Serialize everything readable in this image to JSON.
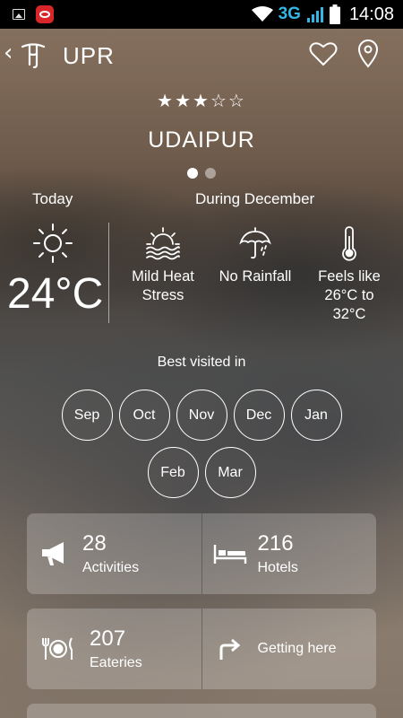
{
  "status_bar": {
    "network": "3G",
    "time": "14:08"
  },
  "header": {
    "back_glyph": "‹",
    "city_code": "UPR",
    "logo_icon": "tourism-logo-icon",
    "favorite_icon": "heart-icon",
    "location_icon": "map-pin-icon"
  },
  "rating": {
    "value": 3,
    "max": 5,
    "display": "★★★☆☆"
  },
  "city_name": "UDAIPUR",
  "pager": {
    "count": 2,
    "active": 0
  },
  "weather": {
    "today_label": "Today",
    "today_temp": "24°C",
    "today_icon": "sun-icon",
    "period_label": "During December",
    "items": [
      {
        "icon": "heat-waves-icon",
        "label_line1": "Mild Heat",
        "label_line2": "Stress",
        "label_line3": ""
      },
      {
        "icon": "umbrella-rain-icon",
        "label_line1": "No Rainfall",
        "label_line2": "",
        "label_line3": ""
      },
      {
        "icon": "thermometer-icon",
        "label_line1": "Feels like",
        "label_line2": "26°C to",
        "label_line3": "32°C"
      }
    ]
  },
  "best_visited": {
    "label": "Best visited in",
    "months": [
      "Sep",
      "Oct",
      "Nov",
      "Dec",
      "Jan",
      "Feb",
      "Mar"
    ]
  },
  "tiles": {
    "activities": {
      "count": "28",
      "label": "Activities",
      "icon": "megaphone-icon"
    },
    "hotels": {
      "count": "216",
      "label": "Hotels",
      "icon": "bed-icon"
    },
    "eateries": {
      "count": "207",
      "label": "Eateries",
      "icon": "fork-plate-knife-icon"
    },
    "getting_here": {
      "label": "Getting here",
      "icon": "turn-right-arrow-icon"
    }
  }
}
